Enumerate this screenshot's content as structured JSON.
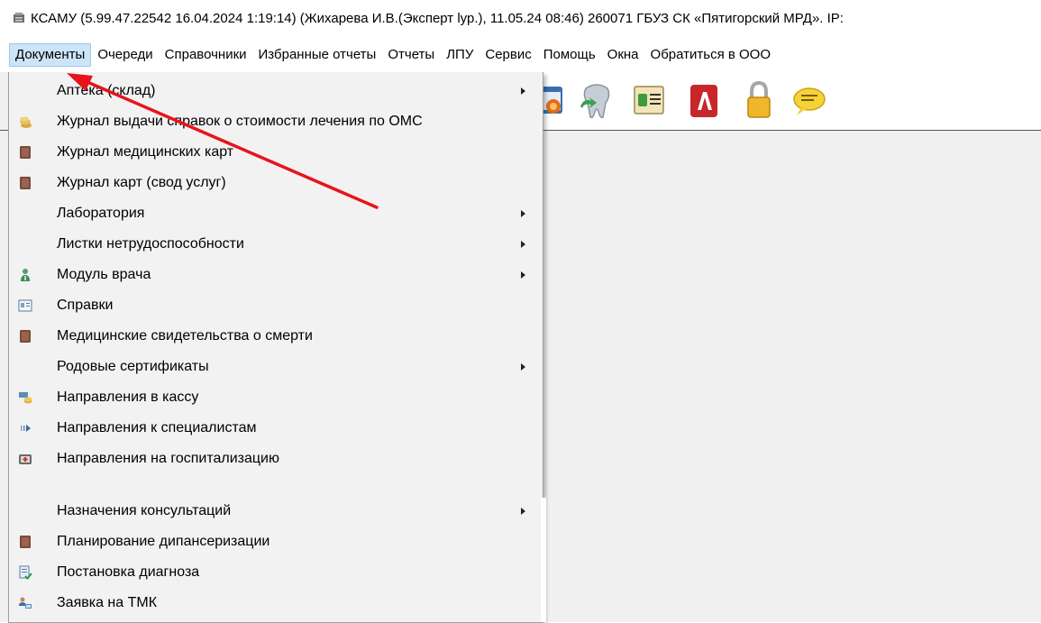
{
  "window": {
    "title": "КСАМУ (5.99.47.22542 16.04.2024 1:19:14) (Жихарева И.В.(Эксперт lур.), 11.05.24 08:46)  260071 ГБУЗ СК «Пятигорский МРД». IP:"
  },
  "menubar": {
    "items": [
      "Документы",
      "Очереди",
      "Справочники",
      "Избранные отчеты",
      "Отчеты",
      "ЛПУ",
      "Сервис",
      "Помощь",
      "Окна",
      "Обратиться в ООО"
    ]
  },
  "toolbar": {
    "icons": [
      "calendar-icon",
      "tooth-icon",
      "id-card-icon",
      "acrobat-icon",
      "padlock-icon",
      "chat-bubble-icon"
    ]
  },
  "documents_menu": {
    "items": [
      {
        "label": "Аптека (склад)",
        "icon": "",
        "submenu": true
      },
      {
        "label": "Журнал выдачи справок о стоимости лечения по ОМС",
        "icon": "coins-icon",
        "submenu": false
      },
      {
        "label": "Журнал медицинских карт",
        "icon": "book-icon",
        "submenu": false
      },
      {
        "label": "Журнал карт (свод услуг)",
        "icon": "book-icon",
        "submenu": false
      },
      {
        "label": "Лаборатория",
        "icon": "",
        "submenu": true
      },
      {
        "label": "Листки нетрудоспособности",
        "icon": "",
        "submenu": true
      },
      {
        "label": "Модуль врача",
        "icon": "doctor-icon",
        "submenu": true
      },
      {
        "label": "Справки",
        "icon": "certificate-icon",
        "submenu": false
      },
      {
        "label": "Медицинские свидетельства о смерти",
        "icon": "book-icon",
        "submenu": false
      },
      {
        "label": "Родовые сертификаты",
        "icon": "",
        "submenu": true
      },
      {
        "label": "Направления в кассу",
        "icon": "cashier-icon",
        "submenu": false
      },
      {
        "label": "Направления к специалистам",
        "icon": "forward-icon",
        "submenu": false
      },
      {
        "label": "Направления на госпитализацию",
        "icon": "hospital-icon",
        "submenu": false
      },
      {
        "label": "Назначения консультаций",
        "icon": "",
        "submenu": true
      },
      {
        "label": "Планирование дипансеризации",
        "icon": "book-icon",
        "submenu": false
      },
      {
        "label": "Постановка диагноза",
        "icon": "diagnosis-check-icon",
        "submenu": false
      },
      {
        "label": "Заявка на ТМК",
        "icon": "telemed-icon",
        "submenu": false
      }
    ]
  },
  "annotation": {
    "color": "#e8141b"
  }
}
